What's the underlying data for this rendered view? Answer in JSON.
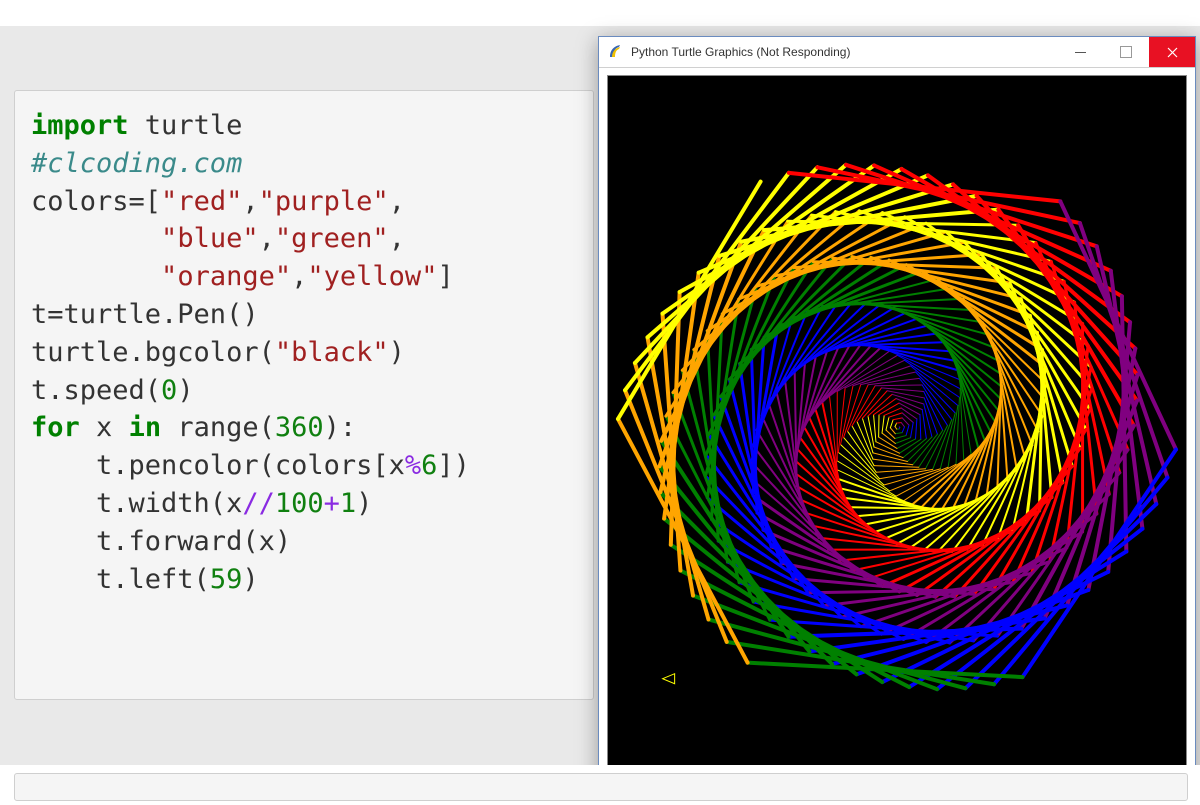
{
  "window": {
    "title": "Python Turtle Graphics (Not Responding)",
    "buttons": {
      "minimize": "–",
      "maximize": "▢",
      "close": "✕"
    }
  },
  "code": {
    "line1_kw": "import",
    "line1_rest": " turtle",
    "line2_comment": "#clcoding.com",
    "colors_assign": "colors=[",
    "q": "\"",
    "c_red": "red",
    "c_purple": "purple",
    "c_blue": "blue",
    "c_green": "green",
    "c_orange": "orange",
    "c_yellow": "yellow",
    "comma": ",",
    "rb": "]",
    "line_pen": "t=turtle.Pen()",
    "line_bg_a": "turtle.bgcolor(",
    "line_bg_str": "black",
    "line_bg_b": ")",
    "line_speed_a": "t.speed(",
    "num0": "0",
    "rp": ")",
    "for_kw": "for",
    "for_mid": " x ",
    "in_kw": "in",
    "range_a": " range(",
    "num360": "360",
    "range_b": "):",
    "pencolor_a": "    t.pencolor(colors[x",
    "mod": "%",
    "num6": "6",
    "pencolor_b": "])",
    "width_a": "    t.width(x",
    "floordiv": "//",
    "num100": "100",
    "plus": "+",
    "num1": "1",
    "forward": "    t.forward(x)",
    "left_a": "    t.left(",
    "num59": "59",
    "left_b": ")"
  },
  "turtle": {
    "bgcolor": "#000000",
    "colors": [
      "red",
      "purple",
      "blue",
      "green",
      "orange",
      "yellow"
    ],
    "iterations": 360,
    "angle": 59,
    "width_formula": "x//100+1",
    "speed": 0
  }
}
